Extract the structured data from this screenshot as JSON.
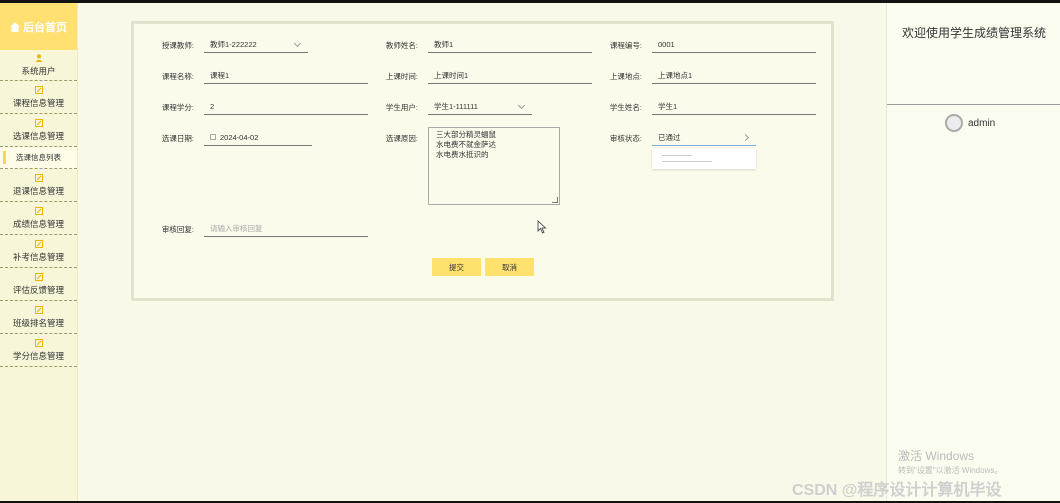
{
  "sidebar": {
    "logo_label": "后台首页",
    "items": [
      {
        "label": "系统用户"
      },
      {
        "label": "课程信息管理"
      },
      {
        "label": "选课信息管理"
      },
      {
        "label": "退课信息管理"
      },
      {
        "label": "成绩信息管理"
      },
      {
        "label": "补考信息管理"
      },
      {
        "label": "评估反馈管理"
      },
      {
        "label": "班级排名管理"
      },
      {
        "label": "学分信息管理"
      }
    ],
    "sub_item": "选课信息列表"
  },
  "header_right": {
    "welcome": "欢迎使用学生成绩管理系统",
    "username": "admin"
  },
  "form": {
    "teacher_label": "授课教师:",
    "teacher_value": "教师1-222222",
    "teacher_name_label": "教师姓名:",
    "teacher_name_value": "教师1",
    "course_no_label": "课程编号:",
    "course_no_value": "0001",
    "course_name_label": "课程名称:",
    "course_name_value": "课程1",
    "class_time_label": "上课时间:",
    "class_time_value": "上课时间1",
    "class_location_label": "上课地点:",
    "class_location_value": "上课地点1",
    "credit_label": "课程学分:",
    "credit_value": "2",
    "student_user_label": "学生用户:",
    "student_user_value": "学生1-111111",
    "student_name_label": "学生姓名:",
    "student_name_value": "学生1",
    "select_date_label": "选课日期:",
    "select_date_value": "2024-04-02",
    "reason_label": "选课原因:",
    "reason_lines": [
      "三大部分精灵蝠鼠",
      "水电费不就金萨达",
      "水电费水抵识的"
    ],
    "review_status_label": "审核状态:",
    "review_status_value": "已通过",
    "review_reply_label": "审核回复:",
    "review_reply_placeholder": "请输入审核回复",
    "submit_label": "提交",
    "cancel_label": "取消"
  },
  "watermark": {
    "activate": "激活 Windows",
    "activate_hint": "转到\"设置\"以激活 Windows。",
    "csdn": "CSDN @程序设计计算机毕设"
  }
}
